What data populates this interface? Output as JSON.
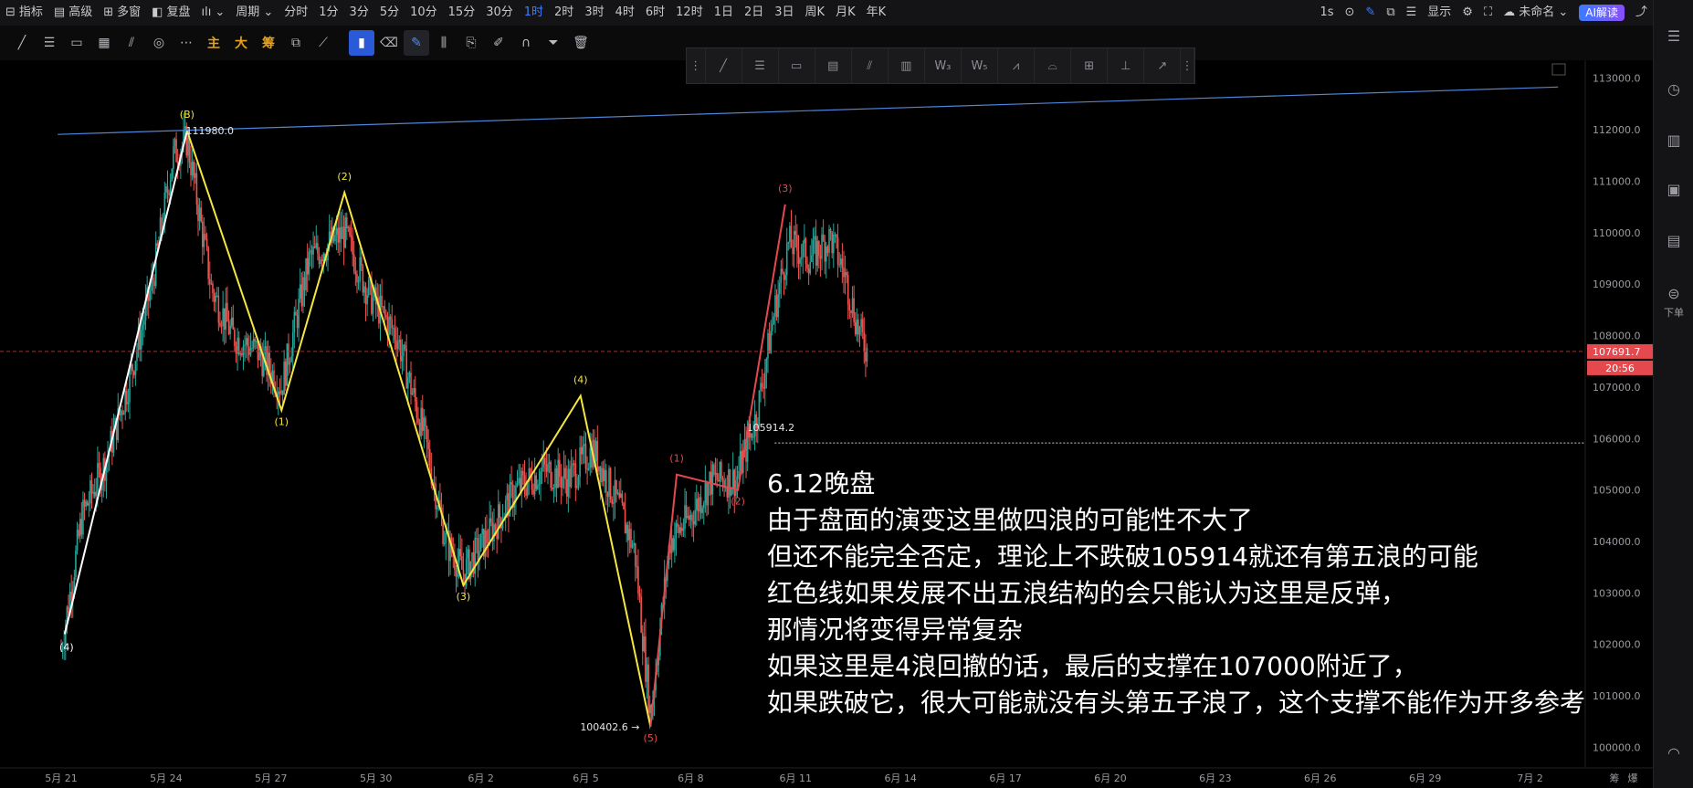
{
  "topbar": {
    "items": [
      {
        "icon": "indicator-icon",
        "label": "指标"
      },
      {
        "icon": "calendar-icon",
        "label": "高级"
      },
      {
        "icon": "grid-icon",
        "label": "多窗"
      },
      {
        "icon": "replay-icon",
        "label": "复盘"
      },
      {
        "icon": "candle-type-icon",
        "label": "⌄"
      },
      {
        "icon": "",
        "label": "周期 ⌄"
      }
    ],
    "intervals": [
      "分时",
      "1分",
      "3分",
      "5分",
      "10分",
      "15分",
      "30分",
      "1时",
      "2时",
      "3时",
      "4时",
      "6时",
      "12时",
      "1日",
      "2日",
      "3日",
      "周K",
      "月K",
      "年K"
    ],
    "active_interval": "1时",
    "right": {
      "speed": "1s",
      "display_label": "显示",
      "layout_name": "未命名 ⌄",
      "ai_label": "AI解读"
    }
  },
  "drawing_toolbar": {
    "cn_tools": [
      "主",
      "大",
      "筹"
    ]
  },
  "right_sidebar": {
    "order_label": "下单"
  },
  "chart_data": {
    "type": "candlestick-with-annotations",
    "price_axis": {
      "ticks": [
        "113000.0",
        "112000.0",
        "111000.0",
        "110000.0",
        "109000.0",
        "108000.0",
        "107000.0",
        "106000.0",
        "105000.0",
        "104000.0",
        "103000.0",
        "102000.0",
        "101000.0",
        "100000.0"
      ],
      "ylim": [
        99600,
        113350
      ]
    },
    "time_axis": {
      "ticks": [
        "5月 21",
        "5月 24",
        "5月 27",
        "5月 30",
        "6月 2",
        "6月 5",
        "6月 8",
        "6月 11",
        "6月 14",
        "6月 17",
        "6月 20",
        "6月 23",
        "6月 26",
        "6月 29",
        "7月 2"
      ],
      "right_labels": [
        "筹",
        "爆"
      ]
    },
    "current_price": {
      "value": 107691.7,
      "label": "107691.7",
      "countdown": "20:56",
      "color": "#e5484d"
    },
    "level_105914": {
      "value": 105914.2,
      "label": "105914.2"
    },
    "trendline": {
      "from": [
        -0.1,
        111910
      ],
      "to": [
        42.8,
        112830
      ],
      "color": "#4f86d9"
    },
    "price_labels": [
      {
        "text": "111980.0",
        "x": 3.2,
        "y": 111980
      },
      {
        "text": "100402.6 →",
        "x": 16.75,
        "y": 100402.6
      }
    ],
    "yellow_wave": {
      "color": "#f5e642",
      "points": [
        [
          3.6,
          111980
        ],
        [
          6.3,
          106550
        ],
        [
          8.1,
          110780
        ],
        [
          11.5,
          103150
        ],
        [
          14.85,
          106830
        ],
        [
          16.85,
          100402.6
        ]
      ],
      "labels": [
        "(B)",
        "(1)",
        "(2)",
        "(3)",
        "(4)",
        "(5)"
      ]
    },
    "white_wave": {
      "color": "#ffffff",
      "points": [
        [
          0.1,
          102200
        ],
        [
          3.6,
          111980
        ]
      ],
      "labels": [
        "(4)"
      ]
    },
    "red_wave": {
      "color": "#e5484d",
      "points": [
        [
          16.85,
          100402.6
        ],
        [
          17.6,
          105300
        ],
        [
          19.35,
          105000
        ],
        [
          20.7,
          110550
        ]
      ],
      "labels": [
        "(1)",
        "(2)",
        "(3)"
      ]
    },
    "candles_hint": "hourly candles following wave path"
  },
  "annotation": {
    "lines": [
      "6.12晚盘",
      "由于盘面的演变这里做四浪的可能性不大了",
      "但还不能完全否定，理论上不跌破105914就还有第五浪的可能",
      "红色线如果发展不出五浪结构的会只能认为这里是反弹，",
      "那情况将变得异常复杂",
      "如果这里是4浪回撤的话，最后的支撑在107000附近了，",
      "如果跌破它，很大可能就没有头第五子浪了，这个支撑不能作为开多参考"
    ]
  },
  "colors": {
    "up": "#26a69a",
    "down": "#ef5350",
    "bg": "#000000",
    "axis_text": "#9a9aa0"
  }
}
